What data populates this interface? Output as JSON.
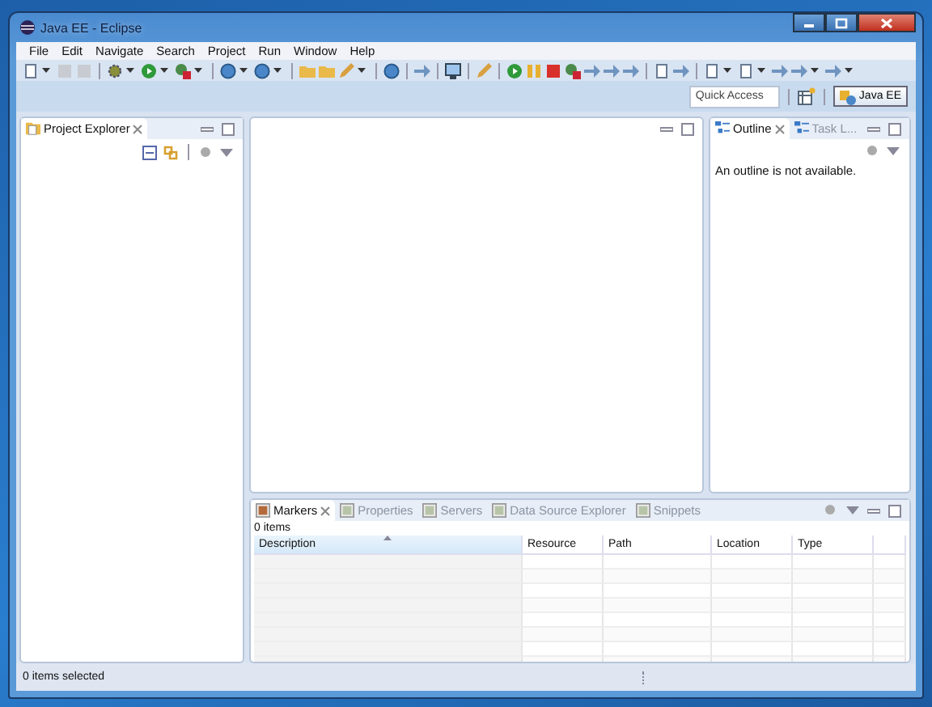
{
  "window": {
    "title": "Java EE - Eclipse"
  },
  "menu": [
    {
      "label": "File"
    },
    {
      "label": "Edit"
    },
    {
      "label": "Navigate"
    },
    {
      "label": "Search"
    },
    {
      "label": "Project"
    },
    {
      "label": "Run"
    },
    {
      "label": "Window"
    },
    {
      "label": "Help"
    }
  ],
  "toolbar": {
    "quick_access": {
      "placeholder": "Quick Access"
    },
    "perspective": {
      "label": "Java EE",
      "selected": true
    }
  },
  "project_explorer": {
    "tabs": [
      {
        "label": "Project Explorer",
        "selected": true
      }
    ]
  },
  "outline": {
    "tabs": [
      {
        "label": "Outline",
        "selected": true
      },
      {
        "label": "Task L...",
        "selected": false
      }
    ],
    "message": "An outline is not available."
  },
  "bottom_panel": {
    "tabs": [
      {
        "label": "Markers",
        "selected": true
      },
      {
        "label": "Properties",
        "selected": false
      },
      {
        "label": "Servers",
        "selected": false
      },
      {
        "label": "Data Source Explorer",
        "selected": false
      },
      {
        "label": "Snippets",
        "selected": false
      }
    ],
    "count": "0 items",
    "columns": [
      {
        "label": "Description",
        "sorted": true
      },
      {
        "label": "Resource",
        "sorted": false
      },
      {
        "label": "Path",
        "sorted": false
      },
      {
        "label": "Location",
        "sorted": false
      },
      {
        "label": "Type",
        "sorted": false
      }
    ]
  },
  "status_bar": {
    "text": "0 items selected"
  }
}
